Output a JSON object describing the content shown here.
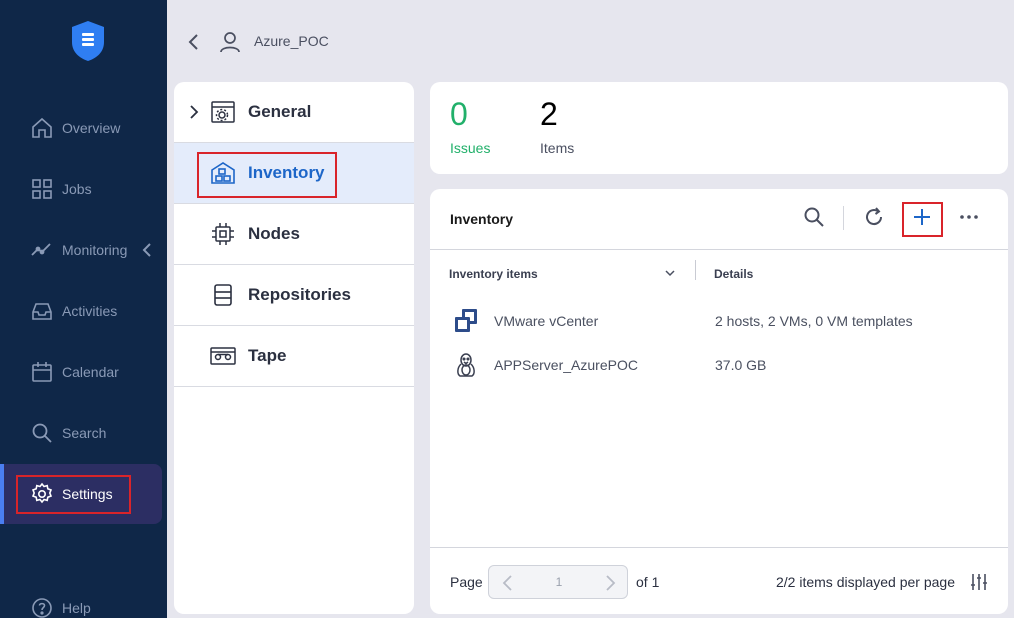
{
  "nav": {
    "items": [
      {
        "label": "Overview",
        "icon": "home-icon"
      },
      {
        "label": "Jobs",
        "icon": "grid-icon"
      },
      {
        "label": "Monitoring",
        "icon": "monitoring-icon"
      },
      {
        "label": "Activities",
        "icon": "inbox-icon"
      },
      {
        "label": "Calendar",
        "icon": "calendar-icon"
      },
      {
        "label": "Search",
        "icon": "search-icon"
      },
      {
        "label": "Settings",
        "icon": "gear-icon"
      },
      {
        "label": "Help",
        "icon": "help-icon"
      }
    ],
    "active": "Settings"
  },
  "header": {
    "breadcrumb": "Azure_POC"
  },
  "settings_list": [
    {
      "label": "General",
      "icon": "general-settings-icon"
    },
    {
      "label": "Inventory",
      "icon": "inventory-icon"
    },
    {
      "label": "Nodes",
      "icon": "chip-icon"
    },
    {
      "label": "Repositories",
      "icon": "repository-icon"
    },
    {
      "label": "Tape",
      "icon": "tape-icon"
    }
  ],
  "stats": {
    "issues": {
      "value": "0",
      "label": "Issues"
    },
    "items": {
      "value": "2",
      "label": "Items"
    }
  },
  "inventory": {
    "title": "Inventory",
    "columns": [
      "Inventory items",
      "Details"
    ],
    "rows": [
      {
        "name": "VMware vCenter",
        "details": "2 hosts, 2 VMs, 0 VM templates",
        "icon": "vcenter-icon"
      },
      {
        "name": "APPServer_AzurePOC",
        "details": "37.0 GB",
        "icon": "linux-penguin-icon"
      }
    ],
    "footer": {
      "page_label": "Page",
      "page_value": "1",
      "of_label": "of 1",
      "per_page": "2/2 items displayed per page"
    }
  },
  "colors": {
    "nav_bg": "#0f2748",
    "accent": "#1d66c8",
    "issues_green": "#21b06a",
    "highlight_red": "#d9242a"
  }
}
